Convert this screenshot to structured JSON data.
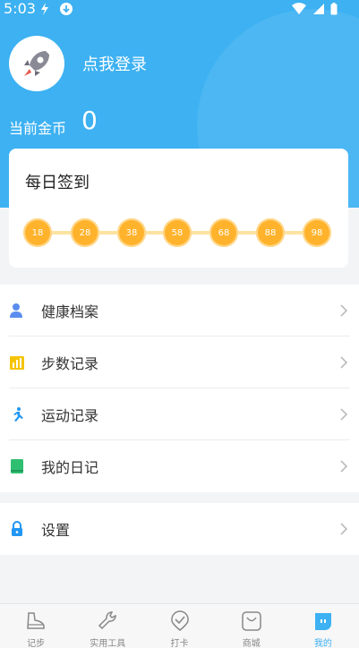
{
  "status_bar": {
    "time": "5:03"
  },
  "profile": {
    "login_text": "点我登录",
    "coins_label": "当前金币",
    "coins_value": "0"
  },
  "signin": {
    "title": "每日签到",
    "days": [
      "18",
      "28",
      "38",
      "58",
      "68",
      "88",
      "98"
    ]
  },
  "menu": {
    "group1": [
      {
        "label": "健康档案",
        "icon": "health-profile-icon",
        "color": "#5b8def"
      },
      {
        "label": "步数记录",
        "icon": "steps-chart-icon",
        "color": "#f5c400"
      },
      {
        "label": "运动记录",
        "icon": "running-icon",
        "color": "#2196f3"
      },
      {
        "label": "我的日记",
        "icon": "diary-book-icon",
        "color": "#2fbf71"
      }
    ],
    "group2": [
      {
        "label": "设置",
        "icon": "lock-icon",
        "color": "#2196f3"
      }
    ]
  },
  "bottom_nav": [
    {
      "label": "记步",
      "icon": "shoe-icon"
    },
    {
      "label": "实用工具",
      "icon": "wrench-icon"
    },
    {
      "label": "打卡",
      "icon": "check-badge-icon"
    },
    {
      "label": "商城",
      "icon": "shopping-bag-icon"
    },
    {
      "label": "我的",
      "icon": "profile-face-icon",
      "active": true
    }
  ],
  "colors": {
    "brand": "#3db1f2",
    "coin": "#ffb22b"
  }
}
